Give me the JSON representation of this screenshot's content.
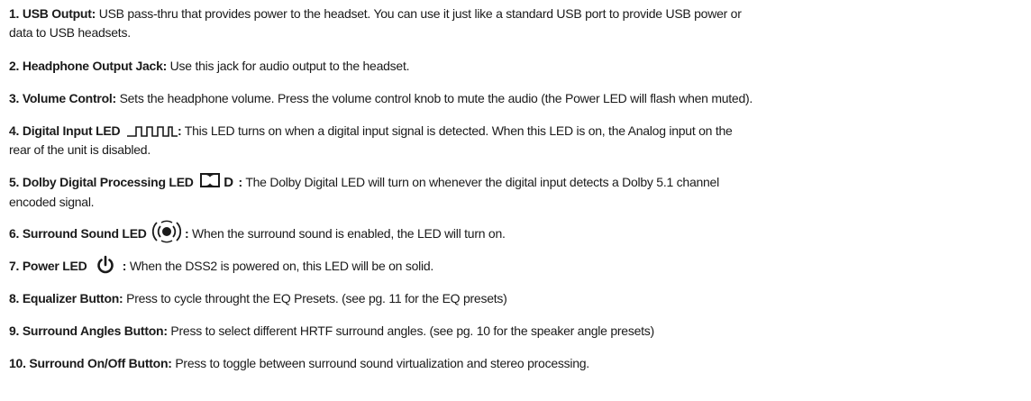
{
  "items": [
    {
      "num": "1.",
      "title": "USB Output:",
      "line1": "USB pass-thru that provides power to the headset. You can use it just like a standard USB port to provide USB power or",
      "line2": "data to USB headsets."
    },
    {
      "num": "2.",
      "title": "Headphone Output Jack:",
      "line1": "Use this jack for audio output to the headset."
    },
    {
      "num": "3.",
      "title": "Volume Control:",
      "line1": "Sets the headphone volume. Press the volume control knob to mute the audio (the Power LED will flash when muted)."
    },
    {
      "num": "4.",
      "title": "Digital Input LED",
      "icon": "digital-waveform-icon",
      "colon": ":",
      "line1": "This LED turns on when a digital input signal is detected. When this LED is on, the Analog input on the",
      "line2": "rear of the unit is disabled."
    },
    {
      "num": "5.",
      "title": "Dolby Digital Processing LED",
      "icon": "dolby-digital-icon",
      "icon_letter": "D",
      "colon": ":",
      "line1": "The Dolby Digital LED will turn on whenever the digital input detects a Dolby 5.1 channel",
      "line2": "encoded signal."
    },
    {
      "num": "6.",
      "title": "Surround Sound LED",
      "icon": "surround-sound-icon",
      "colon": ":",
      "line1": "When the surround sound is enabled, the LED will turn on."
    },
    {
      "num": "7.",
      "title": "Power LED",
      "icon": "power-icon",
      "colon": ":",
      "line1": "When the DSS2 is powered on, this LED will be on solid."
    },
    {
      "num": "8.",
      "title": "Equalizer Button:",
      "line1": "Press to cycle throught the EQ Presets. (see pg. 11 for the EQ presets)"
    },
    {
      "num": "9.",
      "title": "Surround Angles Button:",
      "line1": "Press to select different HRTF surround angles. (see pg. 10 for the speaker angle presets)"
    },
    {
      "num": "10.",
      "title": "Surround On/Off Button:",
      "line1": "Press to toggle between surround sound virtualization and stereo processing."
    }
  ]
}
